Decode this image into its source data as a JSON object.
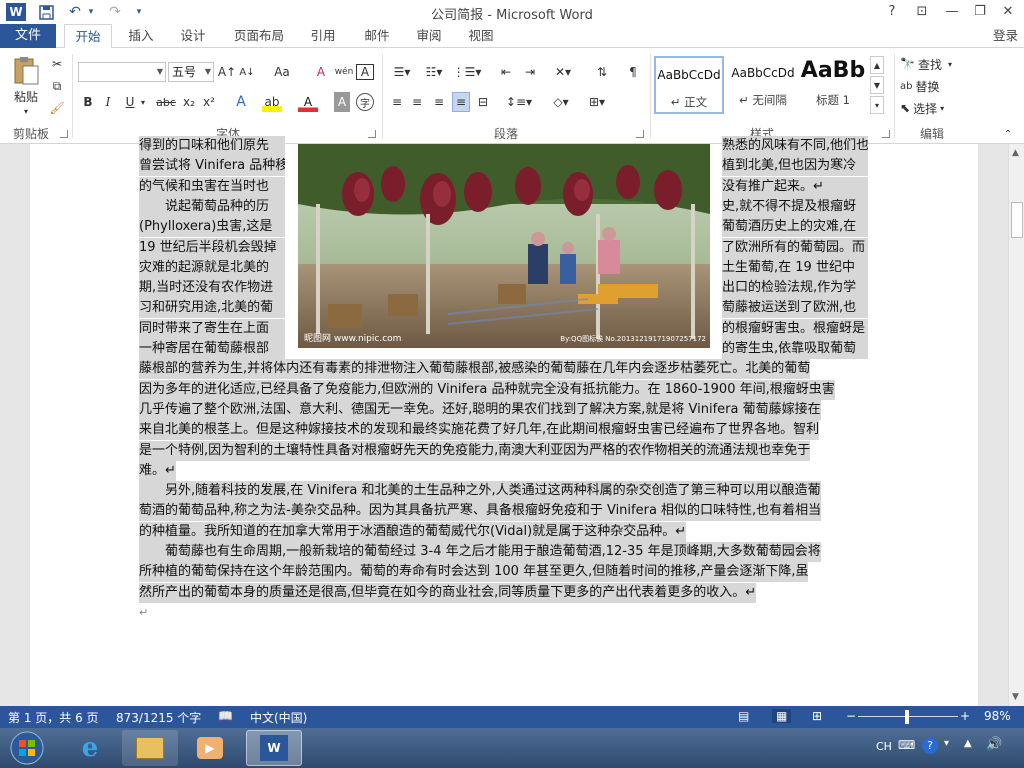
{
  "window": {
    "title": "公司简报 - Microsoft Word"
  },
  "title_controls": {
    "help": "?",
    "ribbon_display": "⊡",
    "minimize": "—",
    "restore": "❐",
    "close": "✕"
  },
  "quick_access": {
    "app_icon": "W",
    "save_icon": "💾",
    "undo_icon": "↶",
    "redo_icon": "↷",
    "more_icon": "▾"
  },
  "tabs": [
    {
      "label": "文件"
    },
    {
      "label": "开始"
    },
    {
      "label": "插入"
    },
    {
      "label": "设计"
    },
    {
      "label": "页面布局"
    },
    {
      "label": "引用"
    },
    {
      "label": "邮件"
    },
    {
      "label": "审阅"
    },
    {
      "label": "视图"
    }
  ],
  "account": {
    "login": "登录"
  },
  "ribbon": {
    "clipboard": {
      "label": "剪贴板",
      "paste": "粘贴"
    },
    "font": {
      "label": "字体",
      "font_name": "",
      "font_size": "五号",
      "bold": "B",
      "italic": "I",
      "underline": "U",
      "strike": "abc",
      "subscript": "x₂",
      "superscript": "x²",
      "grow": "A↑",
      "shrink": "A↓",
      "case": "Aa",
      "clear": "A",
      "pinyin": "wén",
      "border": "A",
      "effects": "A",
      "highlight": "ab",
      "color": "A",
      "shading": "A",
      "enclose": "字"
    },
    "paragraph": {
      "label": "段落"
    },
    "styles": {
      "label": "样式",
      "items": [
        {
          "preview": "AaBbCcDd",
          "name": "↵ 正文"
        },
        {
          "preview": "AaBbCcDd",
          "name": "↵ 无间隔"
        },
        {
          "preview": "AaBb",
          "name": "标题 1"
        }
      ]
    },
    "editing": {
      "label": "编辑",
      "find": "查找",
      "replace": "替换",
      "select": "选择"
    }
  },
  "document": {
    "lines": [
      {
        "left": "得到的口味和他们原先",
        "right": "熟悉的风味有不同,他们也"
      },
      {
        "left": "曾尝试将 Vinifera 品种移",
        "right": "植到北美,但也因为寒冷"
      },
      {
        "left": "的气候和虫害在当时也",
        "right": "没有推广起来。↵"
      },
      {
        "left": "　　说起葡萄品种的历",
        "right": "史,就不得不提及根瘤蚜"
      },
      {
        "left": "(Phylloxera)虫害,这是",
        "right": "葡萄酒历史上的灾难,在"
      },
      {
        "left": "19 世纪后半段机会毁掉",
        "right": "了欧洲所有的葡萄园。而"
      },
      {
        "left": "灾难的起源就是北美的",
        "right": "土生葡萄,在 19 世纪中"
      },
      {
        "left": "期,当时还没有农作物进",
        "right": "出口的检验法规,作为学"
      },
      {
        "left": "习和研究用途,北美的葡",
        "right": "萄藤被运送到了欧洲,也"
      },
      {
        "left": "同时带来了寄生在上面",
        "right": "的根瘤蚜害虫。根瘤蚜是"
      },
      {
        "left": "一种寄居在葡萄藤根部",
        "right": "的寄生虫,依靠吸取葡萄"
      },
      {
        "full": "藤根部的营养为生,并将体内还有毒素的排泄物注入葡萄藤根部,被感染的葡萄藤在几年内会逐步枯萎死亡。北美的葡萄"
      },
      {
        "full": "因为多年的进化适应,已经具备了免疫能力,但欧洲的 Vinifera 品种就完全没有抵抗能力。在 1860-1900 年间,根瘤蚜虫害"
      },
      {
        "full": "几乎传遍了整个欧洲,法国、意大利、德国无一幸免。还好,聪明的果农们找到了解决方案,就是将 Vinifera 葡萄藤嫁接在"
      },
      {
        "full": "来自北美的根茎上。但是这种嫁接技术的发现和最终实施花费了好几年,在此期间根瘤蚜虫害已经遍布了世界各地。智利"
      },
      {
        "full": "是一个特例,因为智利的土壤特性具备对根瘤蚜先天的免疫能力,南澳大利亚因为严格的农作物相关的流通法规也幸免于"
      },
      {
        "full": "难。↵"
      },
      {
        "full": "　　另外,随着科技的发展,在 Vinifera 和北美的土生品种之外,人类通过这两种科属的杂交创造了第三种可以用以酿造葡"
      },
      {
        "full": "萄酒的葡萄品种,称之为法-美杂交品种。因为其具备抗严寒、具备根瘤蚜免疫和于 Vinifera 相似的口味特性,也有着相当"
      },
      {
        "full": "的种植量。我所知道的在加拿大常用于冰酒酿造的葡萄威代尔(Vidal)就是属于这种杂交品种。↵"
      },
      {
        "full": "　　葡萄藤也有生命周期,一般新栽培的葡萄经过 3-4 年之后才能用于酿造葡萄酒,12-35 年是顶峰期,大多数葡萄园会将"
      },
      {
        "full": "所种植的葡萄保持在这个年龄范围内。葡萄的寿命有时会达到 100 年甚至更久,但随着时间的推移,产量会逐渐下降,虽"
      },
      {
        "full": "然所产出的葡萄本身的质量还是很高,但毕竟在如今的商业社会,同等质量下更多的产出代表着更多的收入。↵"
      },
      {
        "full": "↵",
        "plain": true
      }
    ],
    "photo_watermark_left": "昵图网 www.nipic.com",
    "photo_watermark_right": "By:QQ图标诶 No.20131219171907257172"
  },
  "status": {
    "page": "第 1 页，共 6 页",
    "words": "873/1215 个字",
    "language": "中文(中国)",
    "zoom": "98%",
    "zoom_percent": 98
  },
  "taskbar": {
    "ime": "CH",
    "help": "?"
  }
}
